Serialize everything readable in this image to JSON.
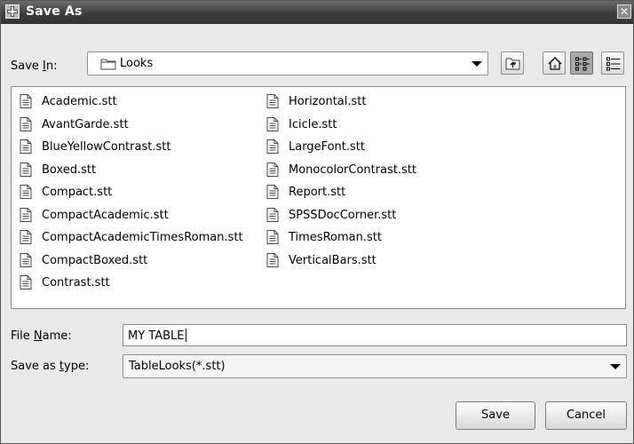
{
  "window": {
    "title": "Save As",
    "close_glyph": "✕"
  },
  "save_in": {
    "label_prefix": "Save ",
    "label_mnemonic": "I",
    "label_suffix": "n:",
    "folder": "Looks",
    "folder_icon": "folder-icon"
  },
  "toolbar": {
    "buttons": [
      "up-one-level-icon",
      "home-icon",
      "list-view-icon",
      "details-view-icon"
    ]
  },
  "files": {
    "column1": [
      "Academic.stt",
      "AvantGarde.stt",
      "BlueYellowContrast.stt",
      "Boxed.stt",
      "Compact.stt",
      "CompactAcademic.stt",
      "CompactAcademicTimesRoman.stt",
      "CompactBoxed.stt",
      "Contrast.stt"
    ],
    "column2": [
      "Horizontal.stt",
      "Icicle.stt",
      "LargeFont.stt",
      "MonocolorContrast.stt",
      "Report.stt",
      "SPSSDocCorner.stt",
      "TimesRoman.stt",
      "VerticalBars.stt"
    ]
  },
  "file_name": {
    "label_prefix": "File ",
    "label_mnemonic": "N",
    "label_suffix": "ame:",
    "value": "MY TABLE"
  },
  "save_as_type": {
    "label_prefix": "Save as ",
    "label_mnemonic": "t",
    "label_suffix": "ype:",
    "value": "TableLooks(*.stt)"
  },
  "buttons": {
    "save": "Save",
    "cancel": "Cancel"
  }
}
